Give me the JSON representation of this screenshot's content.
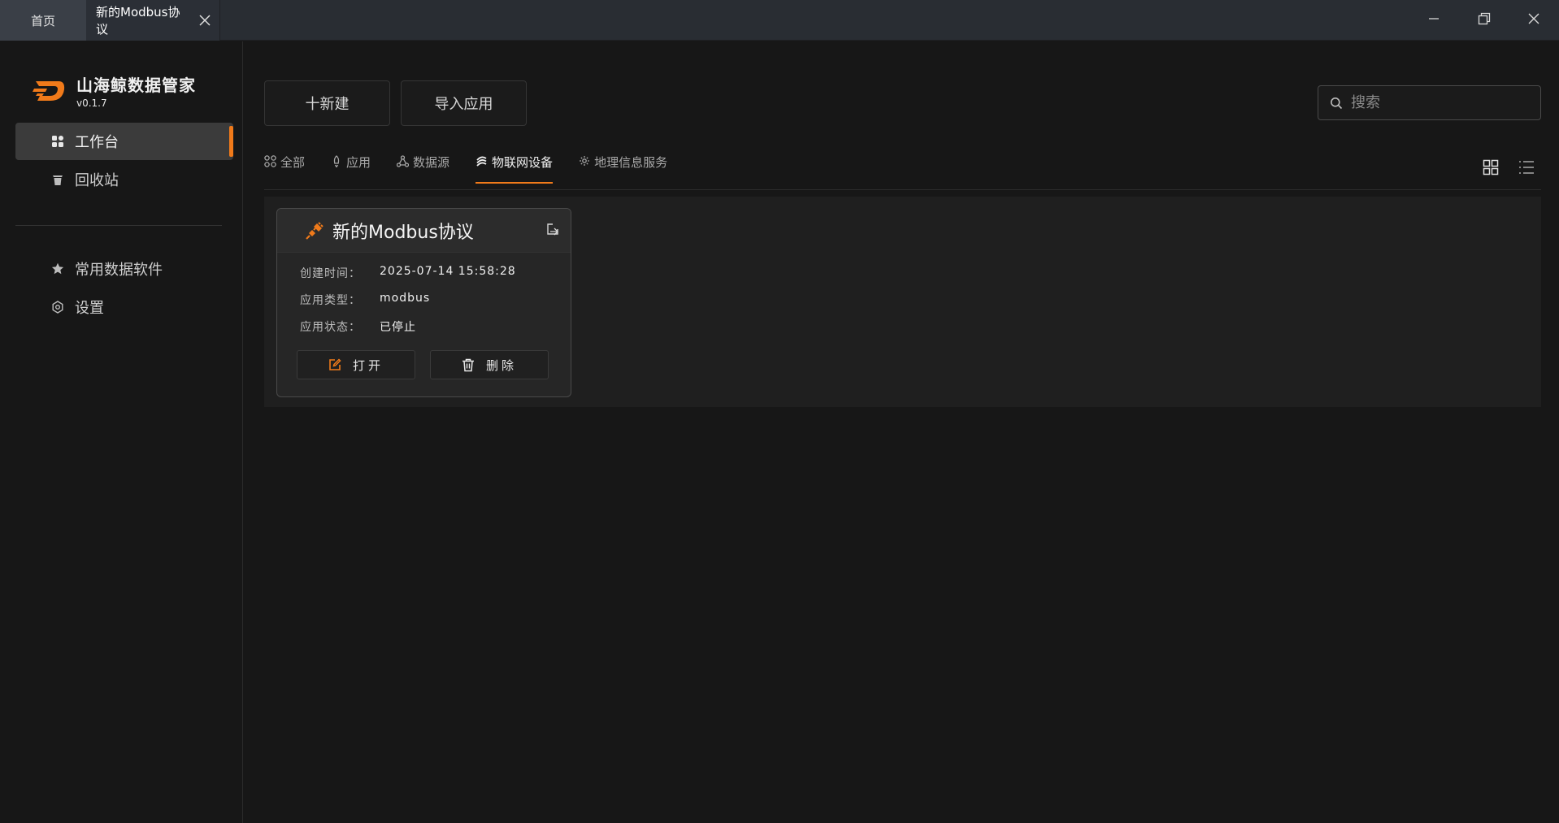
{
  "titlebar": {
    "tabs": [
      {
        "label": "首页"
      },
      {
        "label": "新的Modbus协议"
      }
    ]
  },
  "sidebar": {
    "app_name": "山海鲸数据管家",
    "version": "v0.1.7",
    "nav": [
      {
        "label": "工作台",
        "icon": "grid-icon",
        "active": true
      },
      {
        "label": "回收站",
        "icon": "trash-icon"
      },
      {
        "label": "常用数据软件",
        "icon": "star-icon"
      },
      {
        "label": "设置",
        "icon": "gear-icon"
      }
    ]
  },
  "toolbar": {
    "new_label": "十新建",
    "import_label": "导入应用",
    "search_placeholder": "搜索"
  },
  "filters": [
    {
      "label": "全部",
      "icon": "apps-icon"
    },
    {
      "label": "应用",
      "icon": "rocket-icon"
    },
    {
      "label": "数据源",
      "icon": "nodes-icon"
    },
    {
      "label": "物联网设备",
      "icon": "iot-icon",
      "active": true
    },
    {
      "label": "地理信息服务",
      "icon": "gis-icon"
    }
  ],
  "card": {
    "title": "新的Modbus协议",
    "rows": [
      {
        "key": "创建时间：",
        "value": "2025-07-14 15:58:28"
      },
      {
        "key": "应用类型：",
        "value": "modbus"
      },
      {
        "key": "应用状态：",
        "value": "已停止"
      }
    ],
    "open_label": "打开",
    "delete_label": "删除"
  },
  "colors": {
    "accent": "#f07a1a",
    "background": "#171717",
    "titlebar": "#292d33"
  }
}
